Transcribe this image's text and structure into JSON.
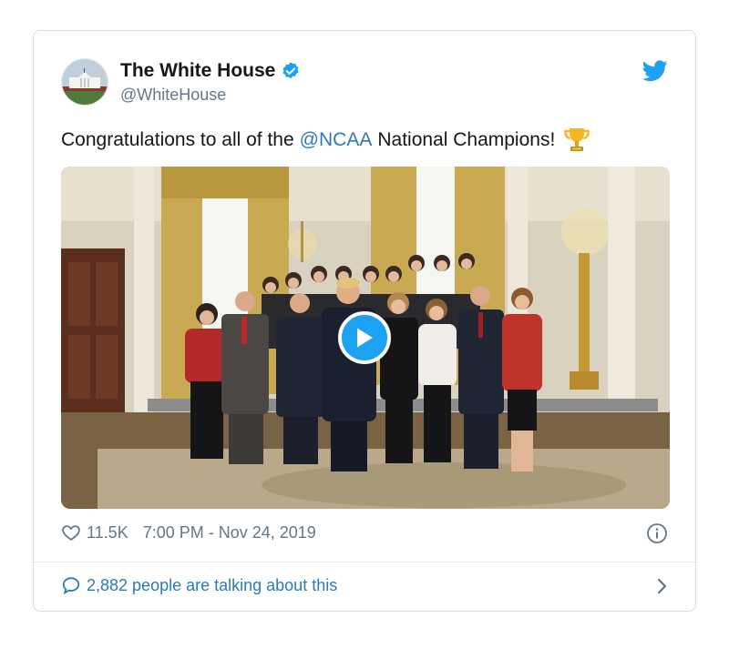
{
  "tweet": {
    "author": {
      "display_name": "The White House",
      "handle": "@WhiteHouse",
      "verified_icon": "verified-badge-icon",
      "avatar": "white-house-building-avatar"
    },
    "text": {
      "before": "Congratulations to all of the",
      "mention": "@NCAA",
      "after": "National Champions!",
      "emoji": "trophy-icon"
    },
    "media": {
      "type": "video",
      "play_icon": "play-icon"
    },
    "likes": "11.5K",
    "timestamp": "7:00 PM - Nov 24, 2019",
    "talking": "2,882 people are talking about this",
    "icons": {
      "source": "twitter-bird-icon",
      "like": "heart-icon",
      "info": "info-icon",
      "reply": "speech-bubble-icon",
      "more": "chevron-right-icon"
    },
    "colors": {
      "accent": "#1da1f2",
      "link": "#2b7bb9",
      "text": "#14171a",
      "muted": "#657786",
      "border": "#e1e8ed"
    }
  }
}
